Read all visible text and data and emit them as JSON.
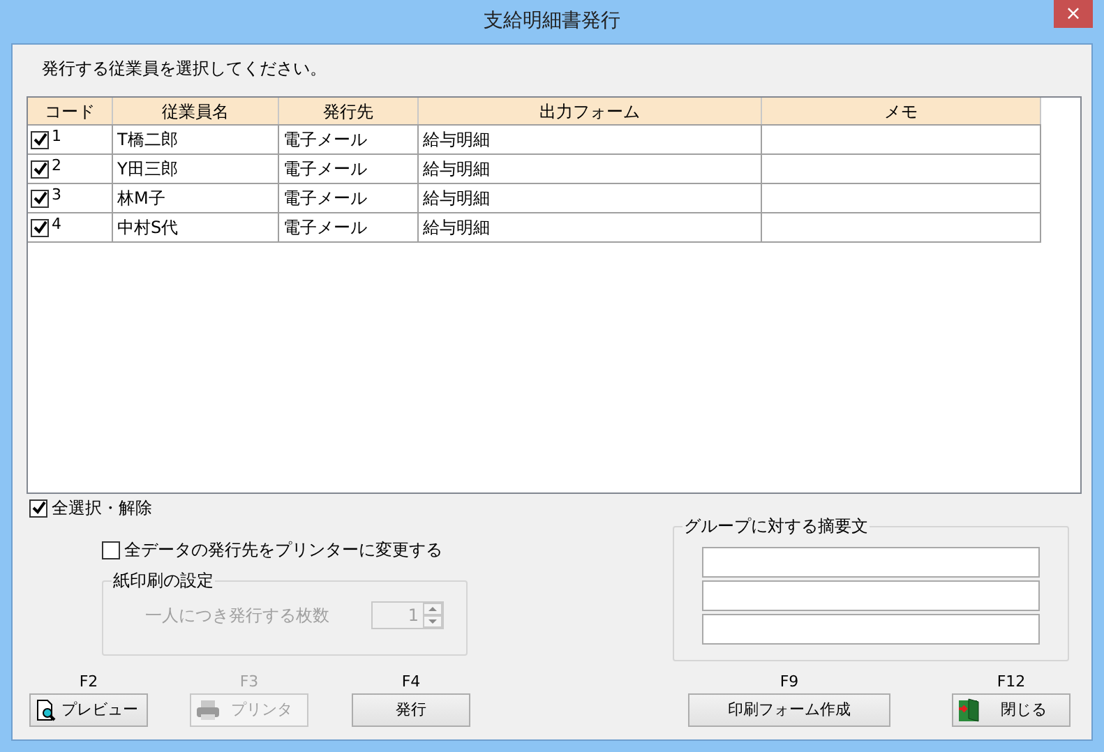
{
  "window": {
    "title": "支給明細書発行",
    "close": "×"
  },
  "instruction": "発行する従業員を選択してください。",
  "table": {
    "columns": [
      "コード",
      "従業員名",
      "発行先",
      "出力フォーム",
      "メモ"
    ],
    "rows": [
      {
        "checked": true,
        "code": "1",
        "name": "T橋二郎",
        "destination": "電子メール",
        "form": "給与明細"
      },
      {
        "checked": true,
        "code": "2",
        "name": "Y田三郎",
        "destination": "電子メール",
        "form": "給与明細"
      },
      {
        "checked": true,
        "code": "3",
        "name": "林M子",
        "destination": "電子メール",
        "form": "給与明細"
      },
      {
        "checked": true,
        "code": "4",
        "name": "中村S代",
        "destination": "電子メール",
        "form": "給与明細"
      }
    ]
  },
  "select_all": {
    "label": "全選択・解除",
    "checked": true
  },
  "printer_all": {
    "label": "全データの発行先をプリンターに変更する",
    "checked": false
  },
  "paper_settings": {
    "title": "紙印刷の設定",
    "disabled": true,
    "copies_label": "一人につき発行する枚数",
    "copies_value": "1"
  },
  "summary_group": {
    "title": "グループに対する摘要文"
  },
  "buttons": [
    {
      "key": "F2",
      "label": "プレビュー",
      "kind": "preview",
      "disabled": false
    },
    {
      "key": "F3",
      "label": "プリンタ",
      "kind": "printer",
      "disabled": true
    },
    {
      "key": "F4",
      "label": "発行",
      "kind": "plain",
      "disabled": false
    },
    {
      "key": "F9",
      "label": "印刷フォーム作成",
      "kind": "plain",
      "disabled": false
    },
    {
      "key": "F12",
      "label": "閉じる",
      "kind": "door",
      "disabled": false
    }
  ]
}
